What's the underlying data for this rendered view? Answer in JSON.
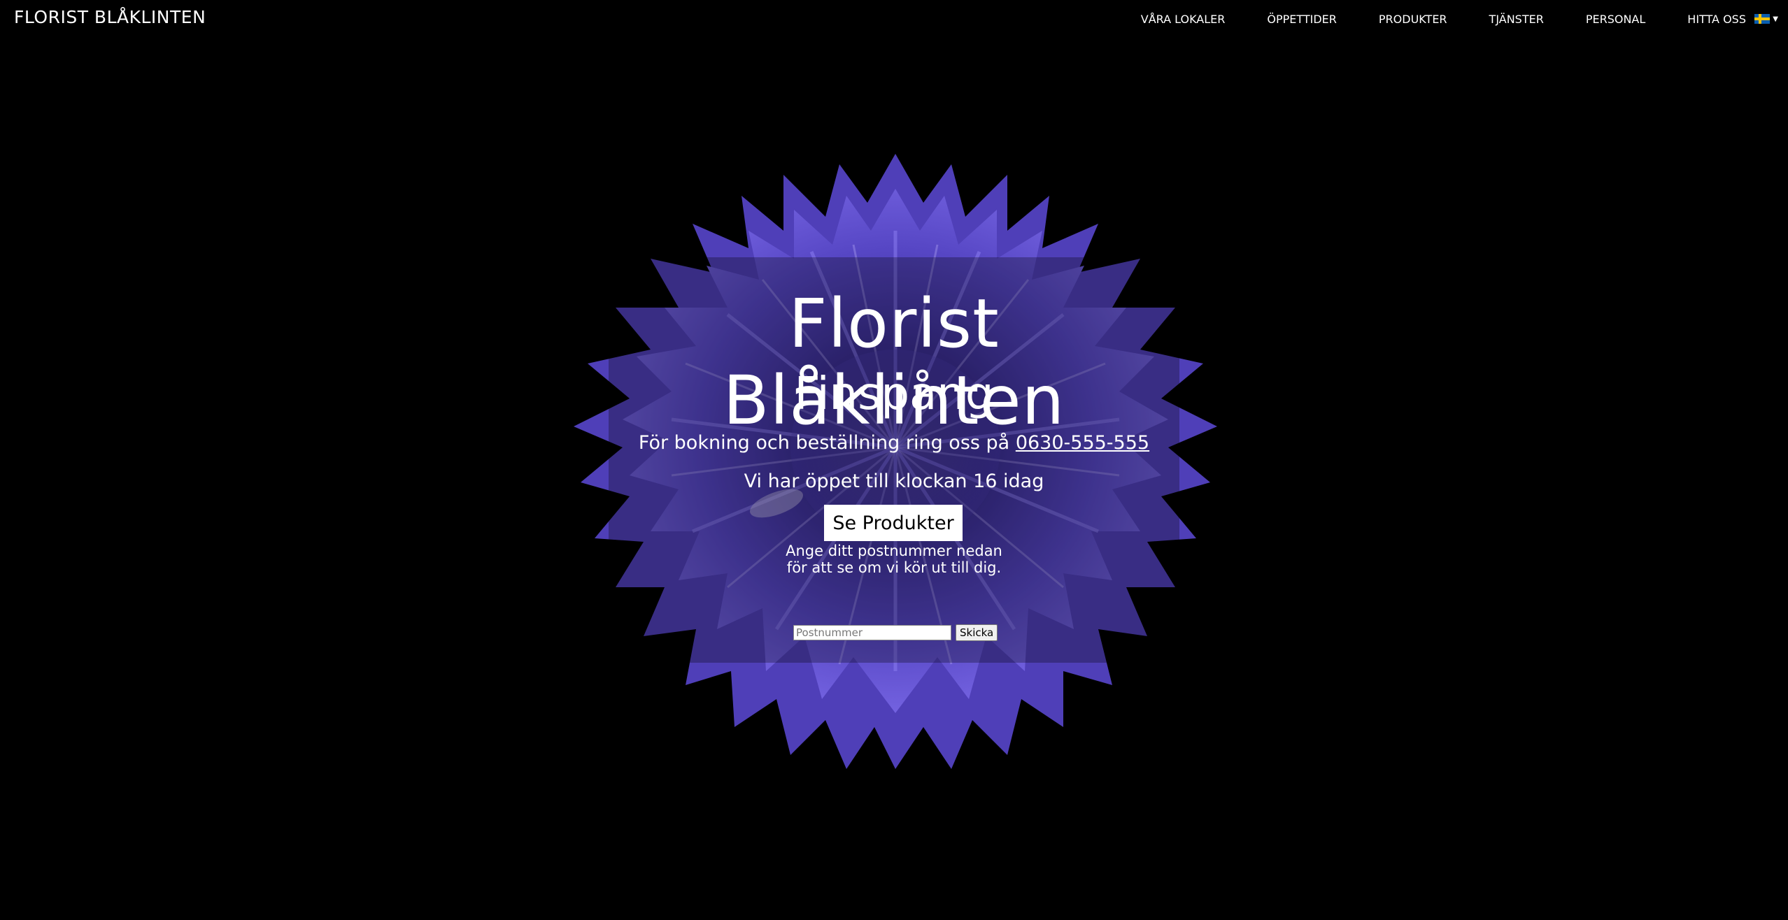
{
  "header": {
    "brand": "FLORIST BLÅKLINTEN",
    "nav": [
      {
        "label": "VÅRA LOKALER"
      },
      {
        "label": "ÖPPETTIDER"
      },
      {
        "label": "PRODUKTER"
      },
      {
        "label": "TJÄNSTER"
      },
      {
        "label": "PERSONAL"
      },
      {
        "label": "HITTA OSS"
      }
    ],
    "language_icon": "swedish-flag-icon"
  },
  "hero": {
    "title": "Florist Blåklinten",
    "subtitle": "Finspång",
    "booking_text": "För bokning och beställning ring oss på",
    "phone": "0630-555-555",
    "open_text": "Vi har öppet till klockan 16 idag",
    "cta_label": "Se Produkter",
    "zip_line1": "Ange ditt postnummer nedan",
    "zip_line2": "för att se om vi kör ut till dig.",
    "zip_placeholder": "Postnummer",
    "zip_submit": "Skicka"
  },
  "colors": {
    "background": "#000000",
    "flower": "#5a49c8",
    "text": "#ffffff"
  }
}
